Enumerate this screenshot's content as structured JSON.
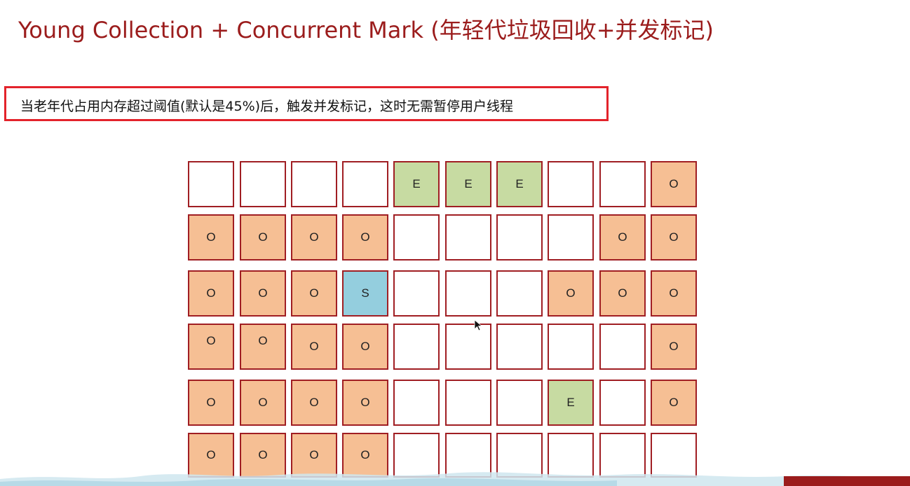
{
  "title": "Young Collection + Concurrent Mark (年轻代垃圾回收+并发标记)",
  "note": "当老年代占用内存超过阈值(默认是45%)后，触发并发标记，这时无需暂停用户线程",
  "colors": {
    "title": "#9b1c1c",
    "note_border": "#e3232b",
    "cell_border": "#a01e23",
    "old": "#f6bf94",
    "eden": "#c7dba2",
    "survivor": "#94cede",
    "empty": "#ffffff"
  },
  "regions": [
    [
      "",
      "",
      "",
      "",
      "E",
      "E",
      "E",
      "",
      "",
      "O"
    ],
    [
      "O",
      "O",
      "O",
      "O",
      "",
      "",
      "",
      "",
      "O",
      "O"
    ],
    [
      "O",
      "O",
      "O",
      "S",
      "",
      "",
      "",
      "O",
      "O",
      "O"
    ],
    [
      "O",
      "O",
      "O",
      "O",
      "",
      "",
      "",
      "",
      "",
      "O"
    ],
    [
      "O",
      "O",
      "O",
      "O",
      "",
      "",
      "",
      "E",
      "",
      "O"
    ],
    [
      "O",
      "O",
      "O",
      "O",
      "",
      "",
      "",
      "",
      "",
      ""
    ]
  ],
  "icons": {
    "cursor": "mouse-pointer-icon"
  }
}
